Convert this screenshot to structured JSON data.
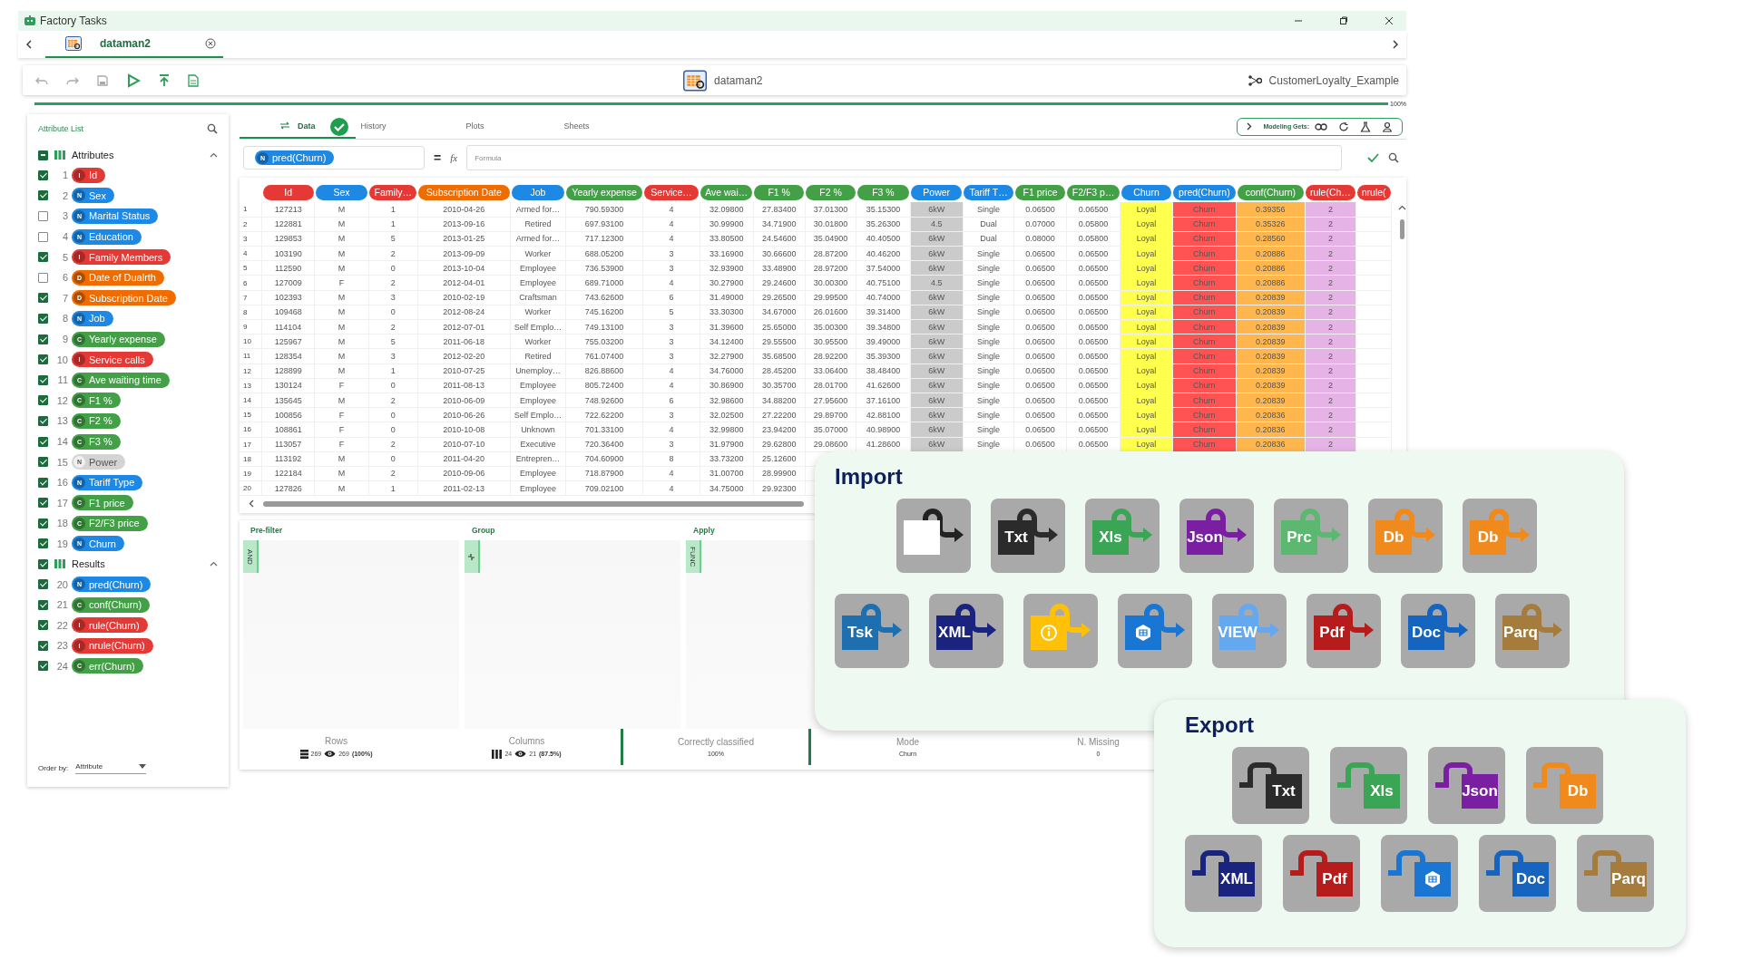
{
  "window": {
    "title": "Factory Tasks"
  },
  "doc_tabs": [
    {
      "label": "dataman2",
      "selected": true
    }
  ],
  "toolbar": {
    "document": "dataman2",
    "project": "CustomerLoyalty_Example"
  },
  "progress": {
    "level": 1,
    "reading": "100%"
  },
  "attribute_list": {
    "title": "Attribute List",
    "groups": [
      {
        "label": "Attributes",
        "checked": true,
        "mixed": true,
        "expanded": true,
        "items": [
          {
            "num": "1",
            "type": "I",
            "name": "Id",
            "checked": true,
            "disabled": false
          },
          {
            "num": "2",
            "type": "N",
            "name": "Sex",
            "checked": true,
            "disabled": false
          },
          {
            "num": "3",
            "type": "N",
            "name": "Marital Status",
            "checked": false,
            "disabled": false
          },
          {
            "num": "4",
            "type": "N",
            "name": "Education",
            "checked": false,
            "disabled": false
          },
          {
            "num": "5",
            "type": "I",
            "name": "Family Members",
            "checked": true,
            "disabled": false
          },
          {
            "num": "6",
            "type": "D",
            "name": "Date of Dualrth",
            "checked": false,
            "disabled": false
          },
          {
            "num": "7",
            "type": "D",
            "name": "Subscription Date",
            "checked": true,
            "disabled": false
          },
          {
            "num": "8",
            "type": "N",
            "name": "Job",
            "checked": true,
            "disabled": false
          },
          {
            "num": "9",
            "type": "C",
            "name": "Yearly expense",
            "checked": true,
            "disabled": false
          },
          {
            "num": "10",
            "type": "I",
            "name": "Service calls",
            "checked": true,
            "disabled": false
          },
          {
            "num": "11",
            "type": "C",
            "name": "Ave waiting time",
            "checked": true,
            "disabled": false
          },
          {
            "num": "12",
            "type": "C",
            "name": "F1 %",
            "checked": true,
            "disabled": false
          },
          {
            "num": "13",
            "type": "C",
            "name": "F2 %",
            "checked": true,
            "disabled": false
          },
          {
            "num": "14",
            "type": "C",
            "name": "F3 %",
            "checked": true,
            "disabled": false
          },
          {
            "num": "15",
            "type": "N",
            "name": "Power",
            "checked": true,
            "disabled": true
          },
          {
            "num": "16",
            "type": "N",
            "name": "Tariff Type",
            "checked": true,
            "disabled": false
          },
          {
            "num": "17",
            "type": "C",
            "name": "F1 price",
            "checked": true,
            "disabled": false
          },
          {
            "num": "18",
            "type": "C",
            "name": "F2/F3 price",
            "checked": true,
            "disabled": false
          },
          {
            "num": "19",
            "type": "N",
            "name": "Churn",
            "checked": true,
            "disabled": false
          }
        ]
      },
      {
        "label": "Results",
        "checked": true,
        "expanded": true,
        "items": [
          {
            "num": "20",
            "type": "N",
            "name": "pred(Churn)",
            "checked": true,
            "disabled": false
          },
          {
            "num": "21",
            "type": "C",
            "name": "conf(Churn)",
            "checked": true,
            "disabled": false
          },
          {
            "num": "22",
            "type": "I",
            "name": "rule(Churn)",
            "checked": true,
            "disabled": false
          },
          {
            "num": "23",
            "type": "I",
            "name": "nrule(Churn)",
            "checked": true,
            "disabled": false
          },
          {
            "num": "24",
            "type": "C",
            "name": "err(Churn)",
            "checked": true,
            "disabled": false
          }
        ]
      }
    ],
    "order_by": {
      "label": "Order by:",
      "value": "Attribute"
    }
  },
  "view_tabs": [
    {
      "label": "Data",
      "selected": true
    },
    {
      "label": "History",
      "selected": false
    },
    {
      "label": "Plots",
      "selected": false
    },
    {
      "label": "Sheets",
      "selected": false
    }
  ],
  "modeling_sets": {
    "label": "Modeling Gets:"
  },
  "formula": {
    "attribute_type": "N",
    "attribute": "pred(Churn)",
    "equals": "=",
    "fx": "fx",
    "placeholder": "Formula"
  },
  "table": {
    "columns": [
      {
        "label": "Id",
        "color": "#e53935"
      },
      {
        "label": "Sex",
        "color": "#1e88e5"
      },
      {
        "label": "Family…",
        "color": "#e53935"
      },
      {
        "label": "Subscription Date",
        "color": "#ef6c00"
      },
      {
        "label": "Job",
        "color": "#1e88e5"
      },
      {
        "label": "Yearly expense",
        "color": "#43a047"
      },
      {
        "label": "Service…",
        "color": "#e53935"
      },
      {
        "label": "Ave wai…",
        "color": "#43a047"
      },
      {
        "label": "F1 %",
        "color": "#43a047"
      },
      {
        "label": "F2 %",
        "color": "#43a047"
      },
      {
        "label": "F3 %",
        "color": "#43a047"
      },
      {
        "label": "Power",
        "color": "#1e88e5",
        "tint": {
          "color": "#cbcbcb"
        }
      },
      {
        "label": "Tariff T…",
        "color": "#1e88e5"
      },
      {
        "label": "F1 price",
        "color": "#43a047"
      },
      {
        "label": "F2/F3 p…",
        "color": "#43a047"
      },
      {
        "label": "Churn",
        "color": "#1e88e5",
        "tint": {
          "color": "#ffff4d"
        }
      },
      {
        "label": "pred(Churn)",
        "color": "#1e88e5",
        "tint": {
          "color": "#ff5252"
        }
      },
      {
        "label": "conf(Churn)",
        "color": "#43a047",
        "tint": {
          "color": "#ffb74d"
        }
      },
      {
        "label": "rule(Ch…",
        "color": "#e53935",
        "tint": {
          "color": "#e6b3e6"
        }
      },
      {
        "label": "nrule(",
        "color": "#e53935"
      }
    ],
    "rows": [
      {
        "num": "1",
        "cells": [
          "127213",
          "M",
          "1",
          "2010-04-26",
          "Armed for…",
          "790.59300",
          "4",
          "32.09800",
          "27.83400",
          "37.01300",
          "35.15300",
          "6kW",
          "Single",
          "0.06500",
          "0.06500",
          "Loyal",
          "Churn",
          "0.39356",
          "2"
        ]
      },
      {
        "num": "2",
        "cells": [
          "122881",
          "M",
          "1",
          "2013-09-16",
          "Retired",
          "697.93100",
          "4",
          "30.99900",
          "34.71900",
          "30.01800",
          "35.26300",
          "4.5",
          "Dual",
          "0.07000",
          "0.05800",
          "Loyal",
          "Churn",
          "0.35326",
          "2"
        ]
      },
      {
        "num": "3",
        "cells": [
          "129853",
          "M",
          "5",
          "2013-01-25",
          "Armed for…",
          "717.12300",
          "4",
          "33.80500",
          "24.54600",
          "35.04900",
          "40.40500",
          "6kW",
          "Dual",
          "0.08000",
          "0.05800",
          "Loyal",
          "Churn",
          "0.28560",
          "2"
        ]
      },
      {
        "num": "4",
        "cells": [
          "103190",
          "M",
          "2",
          "2013-09-09",
          "Worker",
          "688.05200",
          "3",
          "33.16900",
          "30.66600",
          "28.87200",
          "40.46200",
          "6kW",
          "Single",
          "0.06500",
          "0.06500",
          "Loyal",
          "Churn",
          "0.20886",
          "2"
        ]
      },
      {
        "num": "5",
        "cells": [
          "112590",
          "M",
          "0",
          "2013-10-04",
          "Employee",
          "736.53900",
          "3",
          "32.93900",
          "33.48900",
          "28.97200",
          "37.54000",
          "6kW",
          "Single",
          "0.06500",
          "0.06500",
          "Loyal",
          "Churn",
          "0.20886",
          "2"
        ]
      },
      {
        "num": "6",
        "cells": [
          "127009",
          "F",
          "2",
          "2012-04-01",
          "Employee",
          "689.71000",
          "4",
          "30.27900",
          "29.24600",
          "30.00300",
          "40.75100",
          "4.5",
          "Single",
          "0.06500",
          "0.06500",
          "Loyal",
          "Churn",
          "0.20886",
          "2"
        ]
      },
      {
        "num": "7",
        "cells": [
          "102393",
          "M",
          "3",
          "2010-02-19",
          "Craftsman",
          "743.62600",
          "6",
          "31.49000",
          "29.26500",
          "29.99500",
          "40.74000",
          "6kW",
          "Single",
          "0.06500",
          "0.06500",
          "Loyal",
          "Churn",
          "0.20839",
          "2"
        ]
      },
      {
        "num": "8",
        "cells": [
          "109468",
          "M",
          "0",
          "2012-08-24",
          "Worker",
          "745.16200",
          "5",
          "33.30300",
          "34.67000",
          "26.01600",
          "39.31400",
          "6kW",
          "Single",
          "0.06500",
          "0.06500",
          "Loyal",
          "Churn",
          "0.20839",
          "2"
        ]
      },
      {
        "num": "9",
        "cells": [
          "114104",
          "M",
          "2",
          "2012-07-01",
          "Self Emplo…",
          "749.13100",
          "3",
          "31.39600",
          "25.65000",
          "35.00300",
          "39.34800",
          "6kW",
          "Single",
          "0.06500",
          "0.06500",
          "Loyal",
          "Churn",
          "0.20839",
          "2"
        ]
      },
      {
        "num": "10",
        "cells": [
          "125967",
          "M",
          "5",
          "2011-06-18",
          "Worker",
          "755.03200",
          "3",
          "34.12400",
          "29.55500",
          "30.95500",
          "39.49000",
          "6kW",
          "Single",
          "0.06500",
          "0.06500",
          "Loyal",
          "Churn",
          "0.20839",
          "2"
        ]
      },
      {
        "num": "11",
        "cells": [
          "128354",
          "M",
          "3",
          "2012-02-20",
          "Retired",
          "761.07400",
          "3",
          "32.27900",
          "35.68500",
          "28.92200",
          "35.39300",
          "6kW",
          "Single",
          "0.06500",
          "0.06500",
          "Loyal",
          "Churn",
          "0.20839",
          "2"
        ]
      },
      {
        "num": "12",
        "cells": [
          "128899",
          "M",
          "1",
          "2010-07-25",
          "Unemploy…",
          "826.88600",
          "4",
          "34.76000",
          "28.45200",
          "33.06400",
          "38.48400",
          "6kW",
          "Single",
          "0.06500",
          "0.06500",
          "Loyal",
          "Churn",
          "0.20839",
          "2"
        ]
      },
      {
        "num": "13",
        "cells": [
          "130124",
          "F",
          "0",
          "2011-08-13",
          "Employee",
          "805.72400",
          "4",
          "30.86900",
          "30.35700",
          "28.01700",
          "41.62600",
          "6kW",
          "Single",
          "0.06500",
          "0.06500",
          "Loyal",
          "Churn",
          "0.20839",
          "2"
        ]
      },
      {
        "num": "14",
        "cells": [
          "135645",
          "M",
          "2",
          "2010-06-09",
          "Employee",
          "748.92600",
          "6",
          "32.98600",
          "34.88200",
          "27.95600",
          "37.16100",
          "6kW",
          "Single",
          "0.06500",
          "0.06500",
          "Loyal",
          "Churn",
          "0.20839",
          "2"
        ]
      },
      {
        "num": "15",
        "cells": [
          "100856",
          "F",
          "0",
          "2010-06-26",
          "Self Emplo…",
          "722.62200",
          "3",
          "32.02500",
          "27.22200",
          "29.89700",
          "42.88100",
          "6kW",
          "Single",
          "0.06500",
          "0.06500",
          "Loyal",
          "Churn",
          "0.20836",
          "2"
        ]
      },
      {
        "num": "16",
        "cells": [
          "108861",
          "F",
          "0",
          "2010-10-08",
          "Unknown",
          "701.33100",
          "4",
          "32.99800",
          "23.94200",
          "35.07000",
          "40.98900",
          "6kW",
          "Single",
          "0.06500",
          "0.06500",
          "Loyal",
          "Churn",
          "0.20836",
          "2"
        ]
      },
      {
        "num": "17",
        "cells": [
          "113057",
          "F",
          "2",
          "2010-07-10",
          "Executive",
          "720.36400",
          "3",
          "31.97900",
          "29.62800",
          "29.08600",
          "41.28600",
          "6kW",
          "Single",
          "0.06500",
          "0.06500",
          "Loyal",
          "Churn",
          "0.20836",
          "2"
        ]
      },
      {
        "num": "18",
        "cells": [
          "113192",
          "M",
          "0",
          "2011-04-20",
          "Entrepren…",
          "704.60900",
          "8",
          "33.73200",
          "25.12600"
        ]
      },
      {
        "num": "19",
        "cells": [
          "122184",
          "M",
          "2",
          "2010-09-06",
          "Employee",
          "718.87900",
          "4",
          "31.00700",
          "28.99900"
        ]
      },
      {
        "num": "20",
        "cells": [
          "127826",
          "M",
          "1",
          "2011-02-13",
          "Employee",
          "709.02100",
          "4",
          "34.75000",
          "29.92300"
        ]
      }
    ]
  },
  "filters": [
    {
      "title": "Pre-filter",
      "kind": "text",
      "tab": "AND"
    },
    {
      "title": "Group",
      "kind": "icon"
    },
    {
      "title": "Apply",
      "kind": "text",
      "tab": "FUNC"
    }
  ],
  "stats": [
    {
      "kind": "rows",
      "label": "Rows",
      "total": "269",
      "visible": "269",
      "share": "(100%)",
      "marked": false
    },
    {
      "kind": "columns",
      "label": "Columns",
      "total": "24",
      "visible": "21",
      "share": "(87.5%)",
      "marked": false
    },
    {
      "kind": "value",
      "label": "Correctly classified",
      "value": "100%",
      "marked": true
    },
    {
      "kind": "value",
      "label": "Mode",
      "value": "Churn",
      "marked": false
    },
    {
      "kind": "value",
      "label": "N. Missing",
      "value": "0",
      "marked": false
    }
  ],
  "import": {
    "title": "Import",
    "rows": [
      [
        {
          "kind": "blank",
          "color": "#ffffff"
        },
        {
          "kind": "label",
          "label": "Txt",
          "color": "#2b2b2b"
        },
        {
          "kind": "label",
          "label": "Xls",
          "color": "#3aa655"
        },
        {
          "kind": "label",
          "label": "Json",
          "color": "#7b1fa2"
        },
        {
          "kind": "label",
          "label": "Prc",
          "color": "#5cb870"
        },
        {
          "kind": "label",
          "label": "Db",
          "color": "#f08a1c"
        },
        {
          "kind": "label",
          "label": "Db",
          "color": "#f08a1c"
        }
      ],
      [
        {
          "kind": "label",
          "label": "Tsk",
          "color": "#1e6fb0"
        },
        {
          "kind": "label",
          "label": "XML",
          "color": "#1a237e"
        },
        {
          "kind": "info",
          "color": "#ffc107"
        },
        {
          "kind": "grid",
          "color": "#1976d2"
        },
        {
          "kind": "label",
          "label": "VIEW",
          "color": "#64a8f0"
        },
        {
          "kind": "label",
          "label": "Pdf",
          "color": "#b71c1c"
        },
        {
          "kind": "label",
          "label": "Doc",
          "color": "#1565c0"
        },
        {
          "kind": "label",
          "label": "Parq",
          "color": "#a67c3d"
        }
      ]
    ]
  },
  "export": {
    "title": "Export",
    "rows": [
      [
        {
          "kind": "label",
          "label": "Txt",
          "color": "#2b2b2b"
        },
        {
          "kind": "label",
          "label": "Xls",
          "color": "#3aa655"
        },
        {
          "kind": "label",
          "label": "Json",
          "color": "#7b1fa2"
        },
        {
          "kind": "label",
          "label": "Db",
          "color": "#f08a1c"
        }
      ],
      [
        {
          "kind": "label",
          "label": "XML",
          "color": "#1a237e"
        },
        {
          "kind": "label",
          "label": "Pdf",
          "color": "#b71c1c"
        },
        {
          "kind": "grid",
          "color": "#1976d2"
        },
        {
          "kind": "label",
          "label": "Doc",
          "color": "#1565c0"
        },
        {
          "kind": "label",
          "label": "Parq",
          "color": "#a67c3d"
        }
      ]
    ]
  }
}
